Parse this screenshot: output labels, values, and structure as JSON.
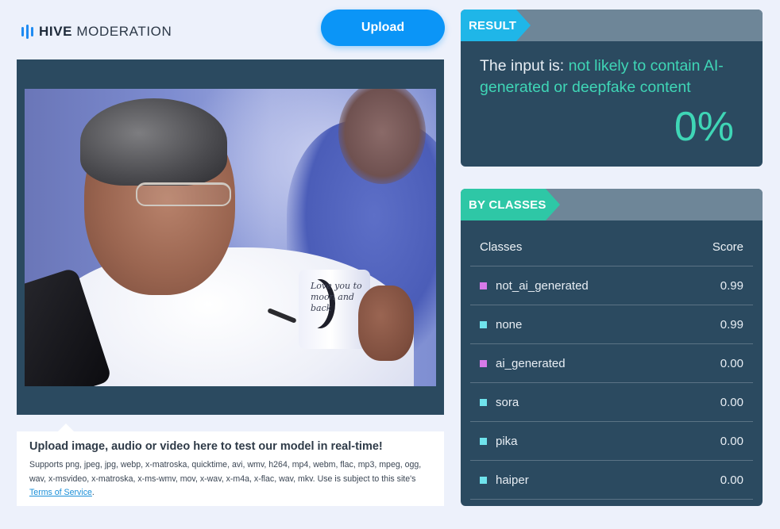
{
  "logo": {
    "brand_bold": "HIVE",
    "brand_light": "MODERATION"
  },
  "upload_label": "Upload",
  "info": {
    "title": "Upload image, audio or video here to test our model in real-time!",
    "desc": "Supports png, jpeg, jpg, webp, x-matroska, quicktime, avi, wmv, h264, mp4, webm, flac, mp3, mpeg, ogg, wav, x-msvideo, x-matroska, x-ms-wmv, mov, x-wav, x-m4a, x-flac, wav, mkv. Use is subject to this site's ",
    "tos_link": "Terms of Service",
    "desc_end": "."
  },
  "preview": {
    "mug_text": "Love you to moon and back"
  },
  "result": {
    "tag": "RESULT",
    "prefix": "The input is: ",
    "verdict": "not likely to contain AI-generated or deepfake content",
    "percent": "0%"
  },
  "classes": {
    "tag": "BY CLASSES",
    "col_class": "Classes",
    "col_score": "Score",
    "rows": [
      {
        "name": "not_ai_generated",
        "score": "0.99",
        "color": "#d77ae8"
      },
      {
        "name": "none",
        "score": "0.99",
        "color": "#6fe3ec"
      },
      {
        "name": "ai_generated",
        "score": "0.00",
        "color": "#d77ae8"
      },
      {
        "name": "sora",
        "score": "0.00",
        "color": "#6fe3ec"
      },
      {
        "name": "pika",
        "score": "0.00",
        "color": "#6fe3ec"
      },
      {
        "name": "haiper",
        "score": "0.00",
        "color": "#6fe3ec"
      }
    ]
  },
  "colors": {
    "accent_blue": "#0b95f7",
    "result_tag": "#1fb6e8",
    "classes_tag": "#2ec7a6",
    "panel_bg": "#2b4a60",
    "verdict": "#3fd6b6"
  }
}
